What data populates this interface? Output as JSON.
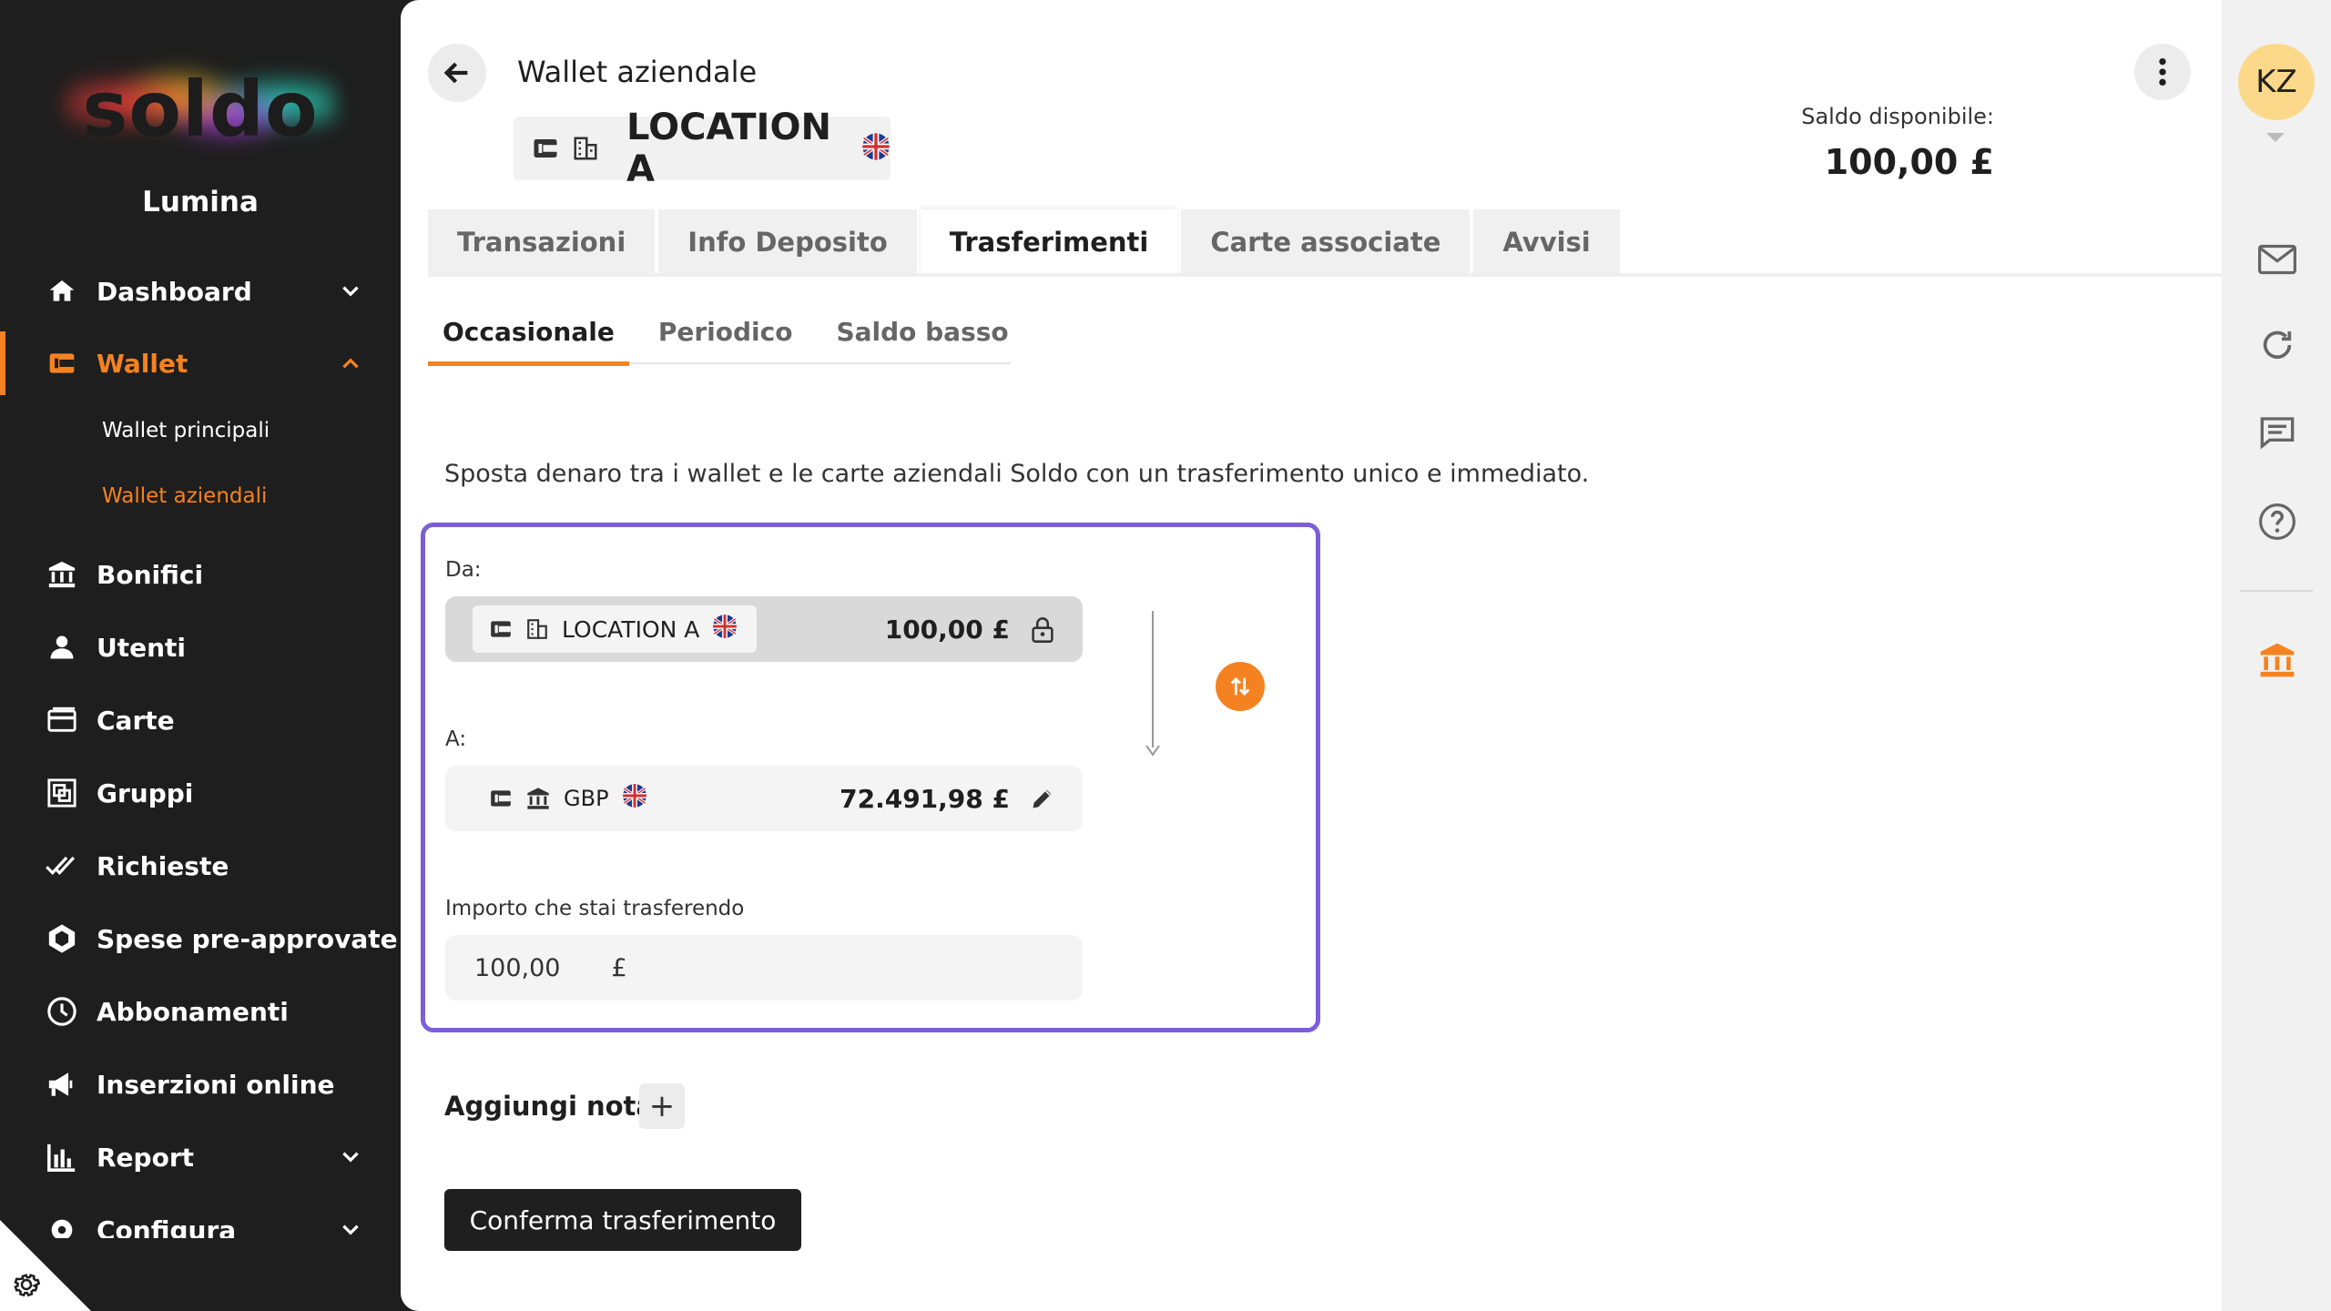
{
  "sidebar": {
    "logo_text": "soldo",
    "company": "Lumina",
    "items": [
      {
        "label": "Dashboard",
        "icon": "home-icon"
      },
      {
        "label": "Wallet",
        "icon": "wallet-icon"
      },
      {
        "label": "Bonifici",
        "icon": "bank-transfer-icon"
      },
      {
        "label": "Utenti",
        "icon": "user-icon"
      },
      {
        "label": "Carte",
        "icon": "card-icon"
      },
      {
        "label": "Gruppi",
        "icon": "groups-icon"
      },
      {
        "label": "Richieste",
        "icon": "double-check-icon"
      },
      {
        "label": "Spese pre-approvate",
        "icon": "shield-icon"
      },
      {
        "label": "Abbonamenti",
        "icon": "clock-icon"
      },
      {
        "label": "Inserzioni online",
        "icon": "megaphone-icon"
      },
      {
        "label": "Report",
        "icon": "bar-chart-icon"
      },
      {
        "label": "Configura",
        "icon": "config-icon"
      }
    ],
    "wallet_sub": [
      "Wallet principali",
      "Wallet aziendali"
    ]
  },
  "header": {
    "title": "Wallet aziendale",
    "wallet_name": "LOCATION A",
    "balance_label": "Saldo disponibile:",
    "balance_value": "100,00 £"
  },
  "tabs": [
    "Transazioni",
    "Info Deposito",
    "Trasferimenti",
    "Carte associate",
    "Avvisi"
  ],
  "subtabs": [
    "Occasionale",
    "Periodico",
    "Saldo basso"
  ],
  "transfer": {
    "description": "Sposta denaro tra i wallet e le carte aziendali Soldo con un trasferimento unico e immediato.",
    "from_label": "Da:",
    "from_name": "LOCATION A",
    "from_amount": "100,00 £",
    "to_label": "A:",
    "to_name": "GBP",
    "to_amount": "72.491,98 £",
    "amount_label": "Importo che stai trasferendo",
    "amount_value": "100,00",
    "amount_currency": "£"
  },
  "note_label": "Aggiungi nota",
  "note_add": "+",
  "confirm_label": "Conferma trasferimento",
  "user_initials": "KZ",
  "colors": {
    "accent": "#f58220",
    "highlight": "#7b5fd6",
    "sidebar": "#1e1e1e"
  }
}
